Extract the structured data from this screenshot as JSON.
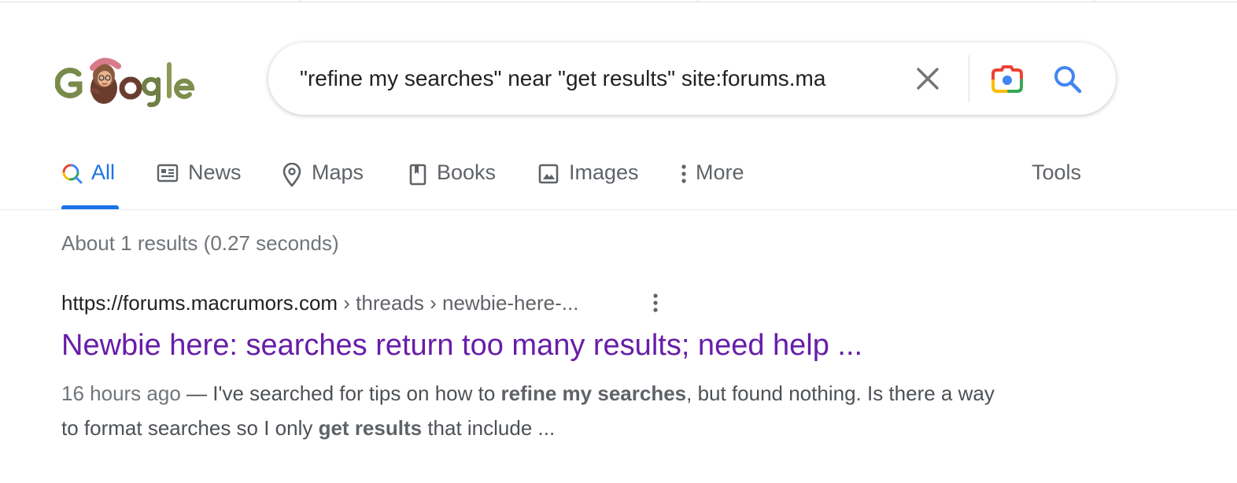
{
  "search": {
    "query": "\"refine my searches\" near \"get results\" site:forums.ma",
    "clear_icon": "close-icon",
    "lens_icon": "google-lens-camera-icon",
    "search_icon": "magnifier-icon"
  },
  "logo": {
    "text": "Google",
    "variant": "doodle"
  },
  "tabs": [
    {
      "label": "All",
      "icon": "colored-search-icon",
      "active": true
    },
    {
      "label": "News",
      "icon": "newspaper-icon",
      "active": false
    },
    {
      "label": "Maps",
      "icon": "map-pin-icon",
      "active": false
    },
    {
      "label": "Books",
      "icon": "book-icon",
      "active": false
    },
    {
      "label": "Images",
      "icon": "image-icon",
      "active": false
    },
    {
      "label": "More",
      "icon": "vertical-dots-icon",
      "active": false
    }
  ],
  "tools_label": "Tools",
  "stats": "About 1 results (0.27 seconds)",
  "result": {
    "site": "https://forums.macrumors.com",
    "crumbs": " › threads › newbie-here-...",
    "title": "Newbie here: searches return too many results; need help ...",
    "date": "16 hours ago",
    "dash": " — ",
    "snippet_1": "I've searched for tips on how to ",
    "snippet_b1": "refine my searches",
    "snippet_2": ", but found nothing. Is there a way to format searches so I only ",
    "snippet_b2": "get results",
    "snippet_3": " that include ..."
  },
  "colors": {
    "accent_blue": "#1a73e8",
    "visited_link": "#681da8",
    "muted_text": "#70757a"
  }
}
